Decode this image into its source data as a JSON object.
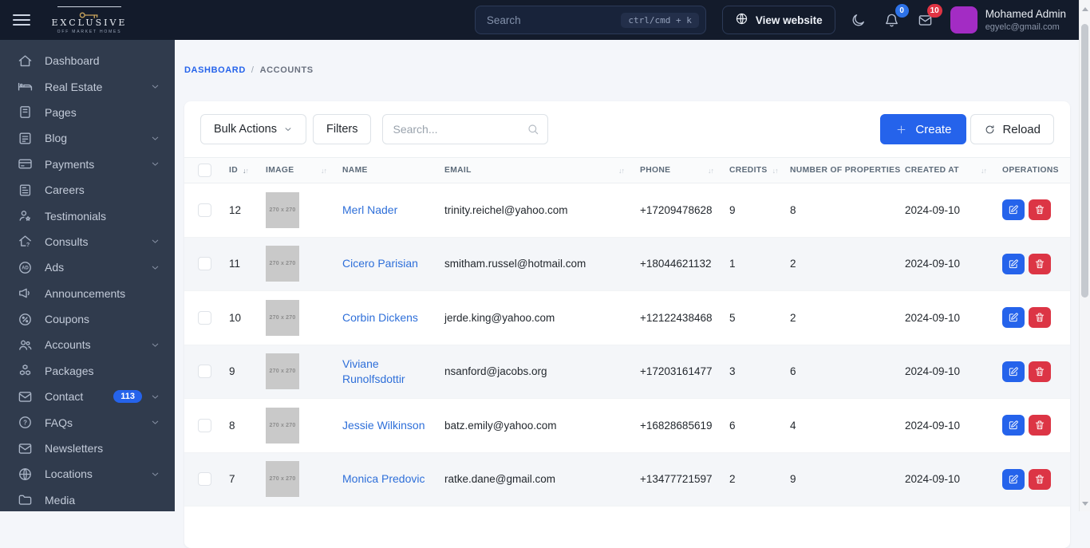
{
  "topbar": {
    "brand": {
      "name": "EXCLUSIVE",
      "tagline": "OFF MARKET HOMES"
    },
    "search": {
      "placeholder": "Search",
      "shortcut": "ctrl/cmd + k"
    },
    "view_website_label": "View website",
    "notifications_badge": "0",
    "messages_badge": "10",
    "user": {
      "name": "Mohamed Admin",
      "email": "egyelc@gmail.com"
    }
  },
  "sidebar": {
    "items": [
      {
        "label": "Dashboard",
        "icon": "home",
        "chevron": false
      },
      {
        "label": "Real Estate",
        "icon": "bed",
        "chevron": true
      },
      {
        "label": "Pages",
        "icon": "book",
        "chevron": false
      },
      {
        "label": "Blog",
        "icon": "list",
        "chevron": true
      },
      {
        "label": "Payments",
        "icon": "credit-card",
        "chevron": true
      },
      {
        "label": "Careers",
        "icon": "newspaper",
        "chevron": false
      },
      {
        "label": "Testimonials",
        "icon": "user-star",
        "chevron": false
      },
      {
        "label": "Consults",
        "icon": "home-question",
        "chevron": true
      },
      {
        "label": "Ads",
        "icon": "ad-circle",
        "chevron": true
      },
      {
        "label": "Announcements",
        "icon": "megaphone",
        "chevron": false
      },
      {
        "label": "Coupons",
        "icon": "percent-badge",
        "chevron": false
      },
      {
        "label": "Accounts",
        "icon": "users",
        "chevron": true
      },
      {
        "label": "Packages",
        "icon": "cubes",
        "chevron": false
      },
      {
        "label": "Contact",
        "icon": "envelope",
        "badge": "113",
        "chevron": true
      },
      {
        "label": "FAQs",
        "icon": "question-circle",
        "chevron": true
      },
      {
        "label": "Newsletters",
        "icon": "envelope",
        "chevron": false
      },
      {
        "label": "Locations",
        "icon": "globe",
        "chevron": true
      },
      {
        "label": "Media",
        "icon": "folder",
        "chevron": false
      }
    ]
  },
  "breadcrumb": {
    "items": [
      "DASHBOARD",
      "ACCOUNTS"
    ],
    "separator": "/"
  },
  "toolbar": {
    "bulk_actions_label": "Bulk Actions",
    "filters_label": "Filters",
    "search_placeholder": "Search...",
    "create_label": "Create",
    "reload_label": "Reload"
  },
  "table": {
    "columns": [
      {
        "key": "select",
        "label": "",
        "type": "checkbox"
      },
      {
        "key": "id",
        "label": "ID",
        "sort": "inline",
        "sort_active": true
      },
      {
        "key": "image",
        "label": "IMAGE",
        "sort": "end"
      },
      {
        "key": "name",
        "label": "NAME"
      },
      {
        "key": "email",
        "label": "EMAIL",
        "sort": "end"
      },
      {
        "key": "phone",
        "label": "PHONE",
        "sort": "end"
      },
      {
        "key": "credits",
        "label": "CREDITS",
        "sort": "inline"
      },
      {
        "key": "properties",
        "label": "NUMBER OF PROPERTIES"
      },
      {
        "key": "created_at",
        "label": "CREATED AT",
        "sort": "end"
      },
      {
        "key": "operations",
        "label": "OPERATIONS"
      }
    ],
    "rows": [
      {
        "id": "12",
        "image_placeholder": "270 x 270",
        "name": "Merl Nader",
        "email": "trinity.reichel@yahoo.com",
        "phone": "+17209478628",
        "credits": "9",
        "properties": "8",
        "created_at": "2024-09-10"
      },
      {
        "id": "11",
        "image_placeholder": "270 x 270",
        "name": "Cicero Parisian",
        "email": "smitham.russel@hotmail.com",
        "phone": "+18044621132",
        "credits": "1",
        "properties": "2",
        "created_at": "2024-09-10"
      },
      {
        "id": "10",
        "image_placeholder": "270 x 270",
        "name": "Corbin Dickens",
        "email": "jerde.king@yahoo.com",
        "phone": "+12122438468",
        "credits": "5",
        "properties": "2",
        "created_at": "2024-09-10"
      },
      {
        "id": "9",
        "image_placeholder": "270 x 270",
        "name": "Viviane Runolfsdottir",
        "email": "nsanford@jacobs.org",
        "phone": "+17203161477",
        "credits": "3",
        "properties": "6",
        "created_at": "2024-09-10"
      },
      {
        "id": "8",
        "image_placeholder": "270 x 270",
        "name": "Jessie Wilkinson",
        "email": "batz.emily@yahoo.com",
        "phone": "+16828685619",
        "credits": "6",
        "properties": "4",
        "created_at": "2024-09-10"
      },
      {
        "id": "7",
        "image_placeholder": "270 x 270",
        "name": "Monica Predovic",
        "email": "ratke.dane@gmail.com",
        "phone": "+13477721597",
        "credits": "2",
        "properties": "9",
        "created_at": "2024-09-10"
      }
    ]
  },
  "colors": {
    "accent": "#2563eb",
    "danger": "#dc3545",
    "topbar_bg": "#131b2b",
    "sidebar_bg": "#303b4d",
    "avatar": "#a32cc4",
    "notifications_badge_bg": "#2d72e8",
    "messages_badge_bg": "#e03444",
    "brand_gold": "#c9a45c",
    "row_stripe": "#f4f6f9"
  }
}
